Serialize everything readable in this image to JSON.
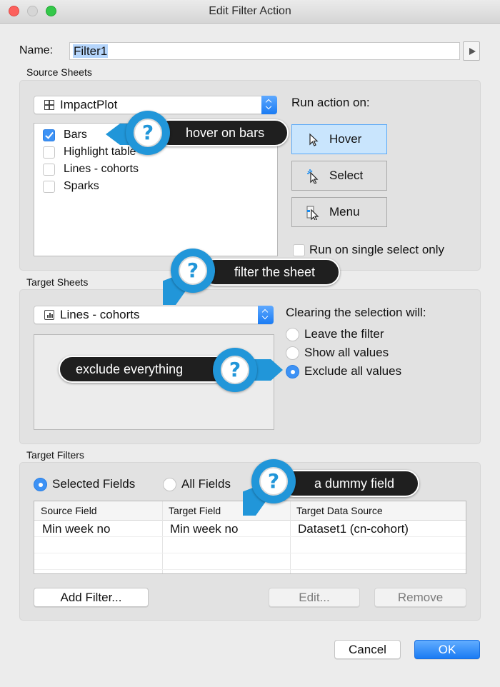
{
  "window": {
    "title": "Edit Filter Action",
    "buttons": [
      "close",
      "minimize",
      "maximize"
    ]
  },
  "name_field": {
    "label": "Name:",
    "value": "Filter1"
  },
  "source_sheets": {
    "section_label": "Source Sheets",
    "dashboard_select": {
      "icon": "dashboard-grid-icon",
      "value": "ImpactPlot"
    },
    "sheets": [
      {
        "label": "Bars",
        "checked": true
      },
      {
        "label": "Highlight table",
        "checked": false
      },
      {
        "label": "Lines - cohorts",
        "checked": false
      },
      {
        "label": "Sparks",
        "checked": false
      }
    ],
    "run_action": {
      "label": "Run action on:",
      "options": [
        {
          "label": "Hover",
          "icon": "hover-cursor-icon",
          "active": true
        },
        {
          "label": "Select",
          "icon": "select-cursor-icon",
          "active": false
        },
        {
          "label": "Menu",
          "icon": "menu-cursor-icon",
          "active": false
        }
      ],
      "single_select_label": "Run on single select only",
      "single_select_checked": false
    }
  },
  "target_sheets": {
    "section_label": "Target Sheets",
    "sheet_select": {
      "icon": "sheet-chart-icon",
      "value": "Lines - cohorts"
    },
    "clearing": {
      "label": "Clearing the selection will:",
      "options": [
        {
          "label": "Leave the filter",
          "selected": false
        },
        {
          "label": "Show all values",
          "selected": false
        },
        {
          "label": "Exclude all values",
          "selected": true
        }
      ]
    }
  },
  "target_filters": {
    "section_label": "Target Filters",
    "scope_options": [
      {
        "label": "Selected Fields",
        "selected": true
      },
      {
        "label": "All Fields",
        "selected": false
      }
    ],
    "table": {
      "columns": [
        "Source Field",
        "Target Field",
        "Target Data Source"
      ],
      "rows": [
        [
          "Min week no",
          "Min week no",
          "Dataset1 (cn-cohort)"
        ]
      ]
    },
    "buttons": {
      "add": "Add Filter...",
      "edit": "Edit...",
      "remove": "Remove"
    }
  },
  "footer": {
    "cancel": "Cancel",
    "ok": "OK"
  },
  "callouts": [
    {
      "text": "hover on bars",
      "icon": "question-icon"
    },
    {
      "text": "filter the sheet",
      "icon": "question-icon"
    },
    {
      "text": "exclude everything",
      "icon": "question-icon"
    },
    {
      "text": "a dummy field",
      "icon": "question-icon"
    }
  ],
  "colors": {
    "accent_blue": "#1a7bf3",
    "callout_blue": "#2196d9",
    "callout_dark": "#1f1f1f",
    "active_toggle": "#c9e5fd"
  }
}
